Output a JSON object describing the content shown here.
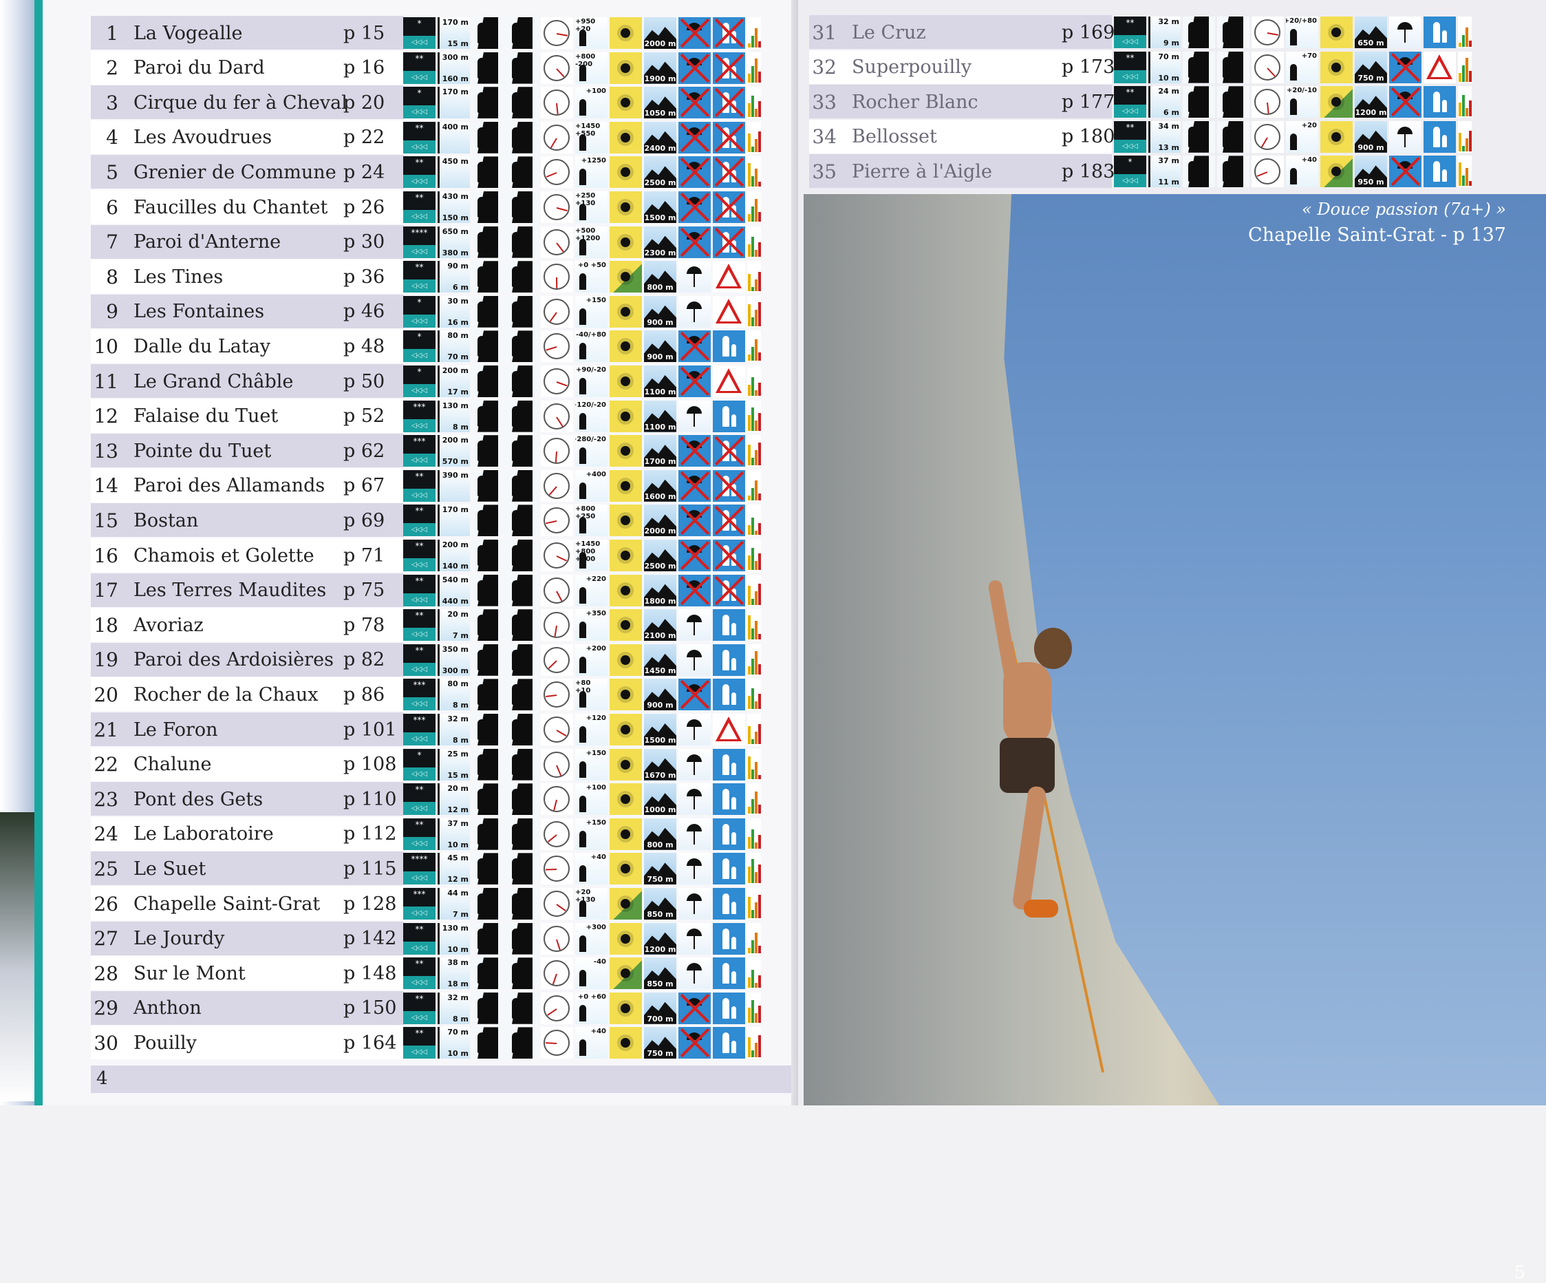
{
  "left_rows": [
    {
      "num": "1",
      "name": "La Vogealle",
      "page": "p 15",
      "stars": "*",
      "h1": "170 m",
      "h2": "15 m",
      "walk": "+950 +20",
      "alt": "2000 m",
      "rain": false,
      "kids": "no",
      "sun": "sun"
    },
    {
      "num": "2",
      "name": "Paroi du Dard",
      "page": "p 16",
      "stars": "**",
      "h1": "300 m",
      "h2": "160 m",
      "walk": "+800 -200",
      "alt": "1900 m",
      "rain": false,
      "kids": "no",
      "sun": "sun"
    },
    {
      "num": "3",
      "name": "Cirque du fer à Cheval",
      "page": "p 20",
      "stars": "*",
      "h1": "170 m",
      "h2": "",
      "walk": "+100",
      "alt": "1050 m",
      "rain": false,
      "kids": "no",
      "sun": "sun"
    },
    {
      "num": "4",
      "name": "Les Avoudrues",
      "page": "p 22",
      "stars": "**",
      "h1": "400 m",
      "h2": "",
      "walk": "+1450 +550",
      "alt": "2400 m",
      "rain": false,
      "kids": "no",
      "sun": "sun"
    },
    {
      "num": "5",
      "name": "Grenier de Commune",
      "page": "p 24",
      "stars": "**",
      "h1": "450 m",
      "h2": "",
      "walk": "+1250",
      "alt": "2500 m",
      "rain": false,
      "kids": "no",
      "sun": "sun"
    },
    {
      "num": "6",
      "name": "Faucilles du Chantet",
      "page": "p 26",
      "stars": "**",
      "h1": "430 m",
      "h2": "150 m",
      "walk": "+250 +130",
      "alt": "1500 m",
      "rain": false,
      "kids": "no",
      "sun": "sun"
    },
    {
      "num": "7",
      "name": "Paroi d'Anterne",
      "page": "p 30",
      "stars": "****",
      "h1": "650 m",
      "h2": "380 m",
      "walk": "+500 +1200",
      "alt": "2300 m",
      "rain": false,
      "kids": "no",
      "sun": "sun"
    },
    {
      "num": "8",
      "name": "Les Tines",
      "page": "p 36",
      "stars": "**",
      "h1": "90 m",
      "h2": "6 m",
      "walk": "+0 +50",
      "alt": "800 m",
      "rain": true,
      "kids": "warn",
      "sun": "shade"
    },
    {
      "num": "9",
      "name": "Les Fontaines",
      "page": "p 46",
      "stars": "*",
      "h1": "30 m",
      "h2": "16 m",
      "walk": "+150",
      "alt": "900 m",
      "rain": true,
      "kids": "warn",
      "sun": "sun"
    },
    {
      "num": "10",
      "name": "Dalle du Latay",
      "page": "p 48",
      "stars": "*",
      "h1": "80 m",
      "h2": "70 m",
      "walk": "-40/+80",
      "alt": "900 m",
      "rain": false,
      "kids": "yes",
      "sun": "sun"
    },
    {
      "num": "11",
      "name": "Le Grand Châble",
      "page": "p 50",
      "stars": "*",
      "h1": "200 m",
      "h2": "17 m",
      "walk": "+90/-20",
      "alt": "1100 m",
      "rain": false,
      "kids": "warn",
      "sun": "sun"
    },
    {
      "num": "12",
      "name": "Falaise du Tuet",
      "page": "p 52",
      "stars": "***",
      "h1": "130 m",
      "h2": "8 m",
      "walk": "+120/-20",
      "alt": "1100 m",
      "rain": true,
      "kids": "yes",
      "sun": "sun"
    },
    {
      "num": "13",
      "name": "Pointe du Tuet",
      "page": "p 62",
      "stars": "***",
      "h1": "200 m",
      "h2": "570 m",
      "walk": "+280/-20",
      "alt": "1700 m",
      "rain": false,
      "kids": "no",
      "sun": "sun"
    },
    {
      "num": "14",
      "name": "Paroi des Allamands",
      "page": "p 67",
      "stars": "**",
      "h1": "390 m",
      "h2": "",
      "walk": "+400",
      "alt": "1600 m",
      "rain": false,
      "kids": "no",
      "sun": "sun"
    },
    {
      "num": "15",
      "name": "Bostan",
      "page": "p 69",
      "stars": "**",
      "h1": "170 m",
      "h2": "",
      "walk": "+800 +250",
      "alt": "2000 m",
      "rain": false,
      "kids": "no",
      "sun": "sun"
    },
    {
      "num": "16",
      "name": "Chamois et Golette",
      "page": "p 71",
      "stars": "**",
      "h1": "200 m",
      "h2": "140 m",
      "walk": "+1450 +800 +800",
      "alt": "2500 m",
      "rain": false,
      "kids": "no",
      "sun": "sun"
    },
    {
      "num": "17",
      "name": "Les Terres Maudites",
      "page": "p 75",
      "stars": "**",
      "h1": "540 m",
      "h2": "440 m",
      "walk": "+220",
      "alt": "1800 m",
      "rain": false,
      "kids": "no",
      "sun": "sun"
    },
    {
      "num": "18",
      "name": "Avoriaz",
      "page": "p 78",
      "stars": "**",
      "h1": "20 m",
      "h2": "7 m",
      "walk": "+350",
      "alt": "2100 m",
      "rain": true,
      "kids": "yes",
      "sun": "sun"
    },
    {
      "num": "19",
      "name": "Paroi des Ardoisières",
      "page": "p 82",
      "stars": "**",
      "h1": "350 m",
      "h2": "300 m",
      "walk": "+200",
      "alt": "1450 m",
      "rain": true,
      "kids": "yes",
      "sun": "sun"
    },
    {
      "num": "20",
      "name": "Rocher de la Chaux",
      "page": "p 86",
      "stars": "***",
      "h1": "80 m",
      "h2": "8 m",
      "walk": "+80 +10",
      "alt": "900 m",
      "rain": false,
      "kids": "yes",
      "sun": "sun"
    },
    {
      "num": "21",
      "name": "Le Foron",
      "page": "p 101",
      "stars": "***",
      "h1": "32 m",
      "h2": "8 m",
      "walk": "+120",
      "alt": "1500 m",
      "rain": true,
      "kids": "warn",
      "sun": "sun"
    },
    {
      "num": "22",
      "name": "Chalune",
      "page": "p 108",
      "stars": "*",
      "h1": "25 m",
      "h2": "15 m",
      "walk": "+150",
      "alt": "1670 m",
      "rain": true,
      "kids": "yes",
      "sun": "sun"
    },
    {
      "num": "23",
      "name": "Pont des Gets",
      "page": "p 110",
      "stars": "**",
      "h1": "20 m",
      "h2": "12 m",
      "walk": "+100",
      "alt": "1000 m",
      "rain": true,
      "kids": "yes",
      "sun": "sun"
    },
    {
      "num": "24",
      "name": "Le Laboratoire",
      "page": "p 112",
      "stars": "**",
      "h1": "37 m",
      "h2": "10 m",
      "walk": "+150",
      "alt": "800 m",
      "rain": true,
      "kids": "yes",
      "sun": "sun"
    },
    {
      "num": "25",
      "name": "Le Suet",
      "page": "p 115",
      "stars": "****",
      "h1": "45 m",
      "h2": "12 m",
      "walk": "+40",
      "alt": "750 m",
      "rain": true,
      "kids": "yes",
      "sun": "sun"
    },
    {
      "num": "26",
      "name": "Chapelle Saint-Grat",
      "page": "p 128",
      "stars": "***",
      "h1": "44 m",
      "h2": "7 m",
      "walk": "+20 +130",
      "alt": "850 m",
      "rain": true,
      "kids": "yes",
      "sun": "shade"
    },
    {
      "num": "27",
      "name": "Le Jourdy",
      "page": "p 142",
      "stars": "**",
      "h1": "130 m",
      "h2": "10 m",
      "walk": "+300",
      "alt": "1200 m",
      "rain": true,
      "kids": "yes",
      "sun": "sun"
    },
    {
      "num": "28",
      "name": "Sur le Mont",
      "page": "p 148",
      "stars": "**",
      "h1": "38 m",
      "h2": "18 m",
      "walk": "-40",
      "alt": "850 m",
      "rain": true,
      "kids": "yes",
      "sun": "shade"
    },
    {
      "num": "29",
      "name": "Anthon",
      "page": "p 150",
      "stars": "**",
      "h1": "32 m",
      "h2": "8 m",
      "walk": "+0 +60",
      "alt": "700 m",
      "rain": false,
      "kids": "yes",
      "sun": "sun"
    },
    {
      "num": "30",
      "name": "Pouilly",
      "page": "p 164",
      "stars": "**",
      "h1": "70 m",
      "h2": "10 m",
      "walk": "+40",
      "alt": "750 m",
      "rain": false,
      "kids": "yes",
      "sun": "sun"
    }
  ],
  "right_rows": [
    {
      "num": "31",
      "name": "Le Cruz",
      "page": "p 169",
      "stars": "**",
      "h1": "32 m",
      "h2": "9 m",
      "walk": "+20/+80",
      "alt": "650 m",
      "rain": true,
      "kids": "yes",
      "sun": "sun"
    },
    {
      "num": "32",
      "name": "Superpouilly",
      "page": "p 173",
      "stars": "**",
      "h1": "70 m",
      "h2": "10 m",
      "walk": "+70",
      "alt": "750 m",
      "rain": false,
      "kids": "warn",
      "sun": "sun"
    },
    {
      "num": "33",
      "name": "Rocher Blanc",
      "page": "p 177",
      "stars": "**",
      "h1": "24 m",
      "h2": "6 m",
      "walk": "+20/-10",
      "alt": "1200 m",
      "rain": false,
      "kids": "yes",
      "sun": "shade"
    },
    {
      "num": "34",
      "name": "Bellosset",
      "page": "p 180",
      "stars": "**",
      "h1": "34 m",
      "h2": "13 m",
      "walk": "+20",
      "alt": "900 m",
      "rain": true,
      "kids": "yes",
      "sun": "sun"
    },
    {
      "num": "35",
      "name": "Pierre à l'Aigle",
      "page": "p 183",
      "stars": "*",
      "h1": "37 m",
      "h2": "11 m",
      "walk": "+40",
      "alt": "950 m",
      "rain": false,
      "kids": "yes",
      "sun": "shade"
    }
  ],
  "caption": {
    "route": "« Douce passion (7a+) »",
    "location": "Chapelle Saint-Grat - p 137"
  },
  "page_numbers": {
    "left": "4",
    "right": "5"
  },
  "colors": {
    "row_band": "#d9d6e6",
    "teal": "#1aa0a0",
    "sky": "#6f98cb",
    "rain_blue": "#2f8bd2",
    "sun_yellow": "#f3de50",
    "cross_red": "#d61f1f"
  }
}
